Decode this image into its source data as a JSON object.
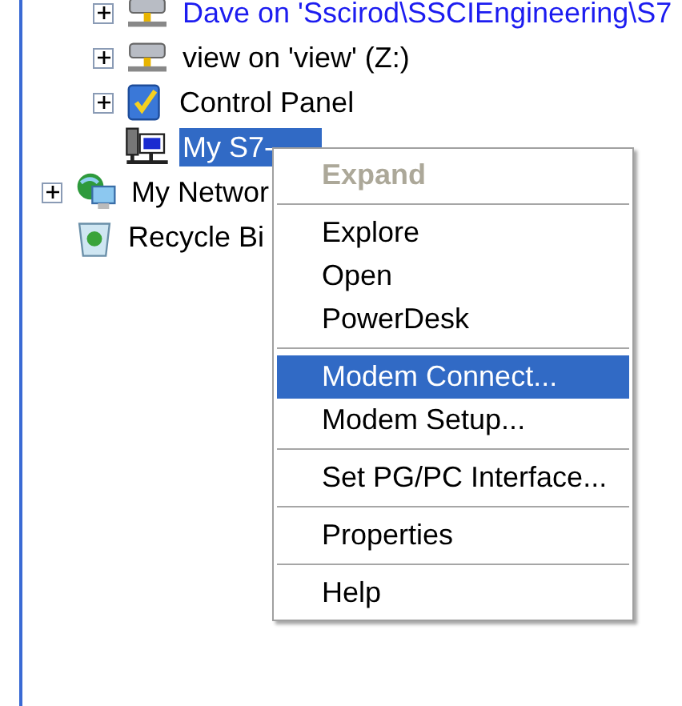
{
  "tree": [
    {
      "children": [
        {
          "label": "Dave on 'Sscirod\\SSCIEngineering\\S7",
          "expandable": true,
          "selected": false,
          "kind": "network-drive",
          "compressed": true
        },
        {
          "label": "view on 'view' (Z:)",
          "expandable": true,
          "selected": false,
          "kind": "network-drive",
          "compressed": false
        },
        {
          "label": "Control Panel",
          "expandable": true,
          "selected": false,
          "kind": "control-panel",
          "compressed": false
        },
        {
          "label": "My S7-",
          "expandable": false,
          "selected": true,
          "kind": "computer-network",
          "compressed": false
        }
      ]
    },
    {
      "label": "My Networ",
      "expandable": true,
      "selected": false,
      "kind": "network-places",
      "compressed": false
    },
    {
      "label": "Recycle Bi",
      "expandable": false,
      "selected": false,
      "kind": "recycle-bin",
      "compressed": false
    }
  ],
  "context_menu": [
    {
      "kind": "item",
      "label": "Expand",
      "disabled": true,
      "bold": true,
      "selected": false
    },
    {
      "kind": "separator"
    },
    {
      "kind": "item",
      "label": "Explore",
      "disabled": false,
      "bold": false,
      "selected": false
    },
    {
      "kind": "item",
      "label": "Open",
      "disabled": false,
      "bold": false,
      "selected": false
    },
    {
      "kind": "item",
      "label": "PowerDesk",
      "disabled": false,
      "bold": false,
      "selected": false
    },
    {
      "kind": "separator"
    },
    {
      "kind": "item",
      "label": "Modem Connect...",
      "disabled": false,
      "bold": false,
      "selected": true
    },
    {
      "kind": "item",
      "label": "Modem Setup...",
      "disabled": false,
      "bold": false,
      "selected": false
    },
    {
      "kind": "separator"
    },
    {
      "kind": "item",
      "label": "Set PG/PC Interface...",
      "disabled": false,
      "bold": false,
      "selected": false
    },
    {
      "kind": "separator"
    },
    {
      "kind": "item",
      "label": "Properties",
      "disabled": false,
      "bold": false,
      "selected": false
    },
    {
      "kind": "separator"
    },
    {
      "kind": "item",
      "label": "Help",
      "disabled": false,
      "bold": false,
      "selected": false
    }
  ]
}
